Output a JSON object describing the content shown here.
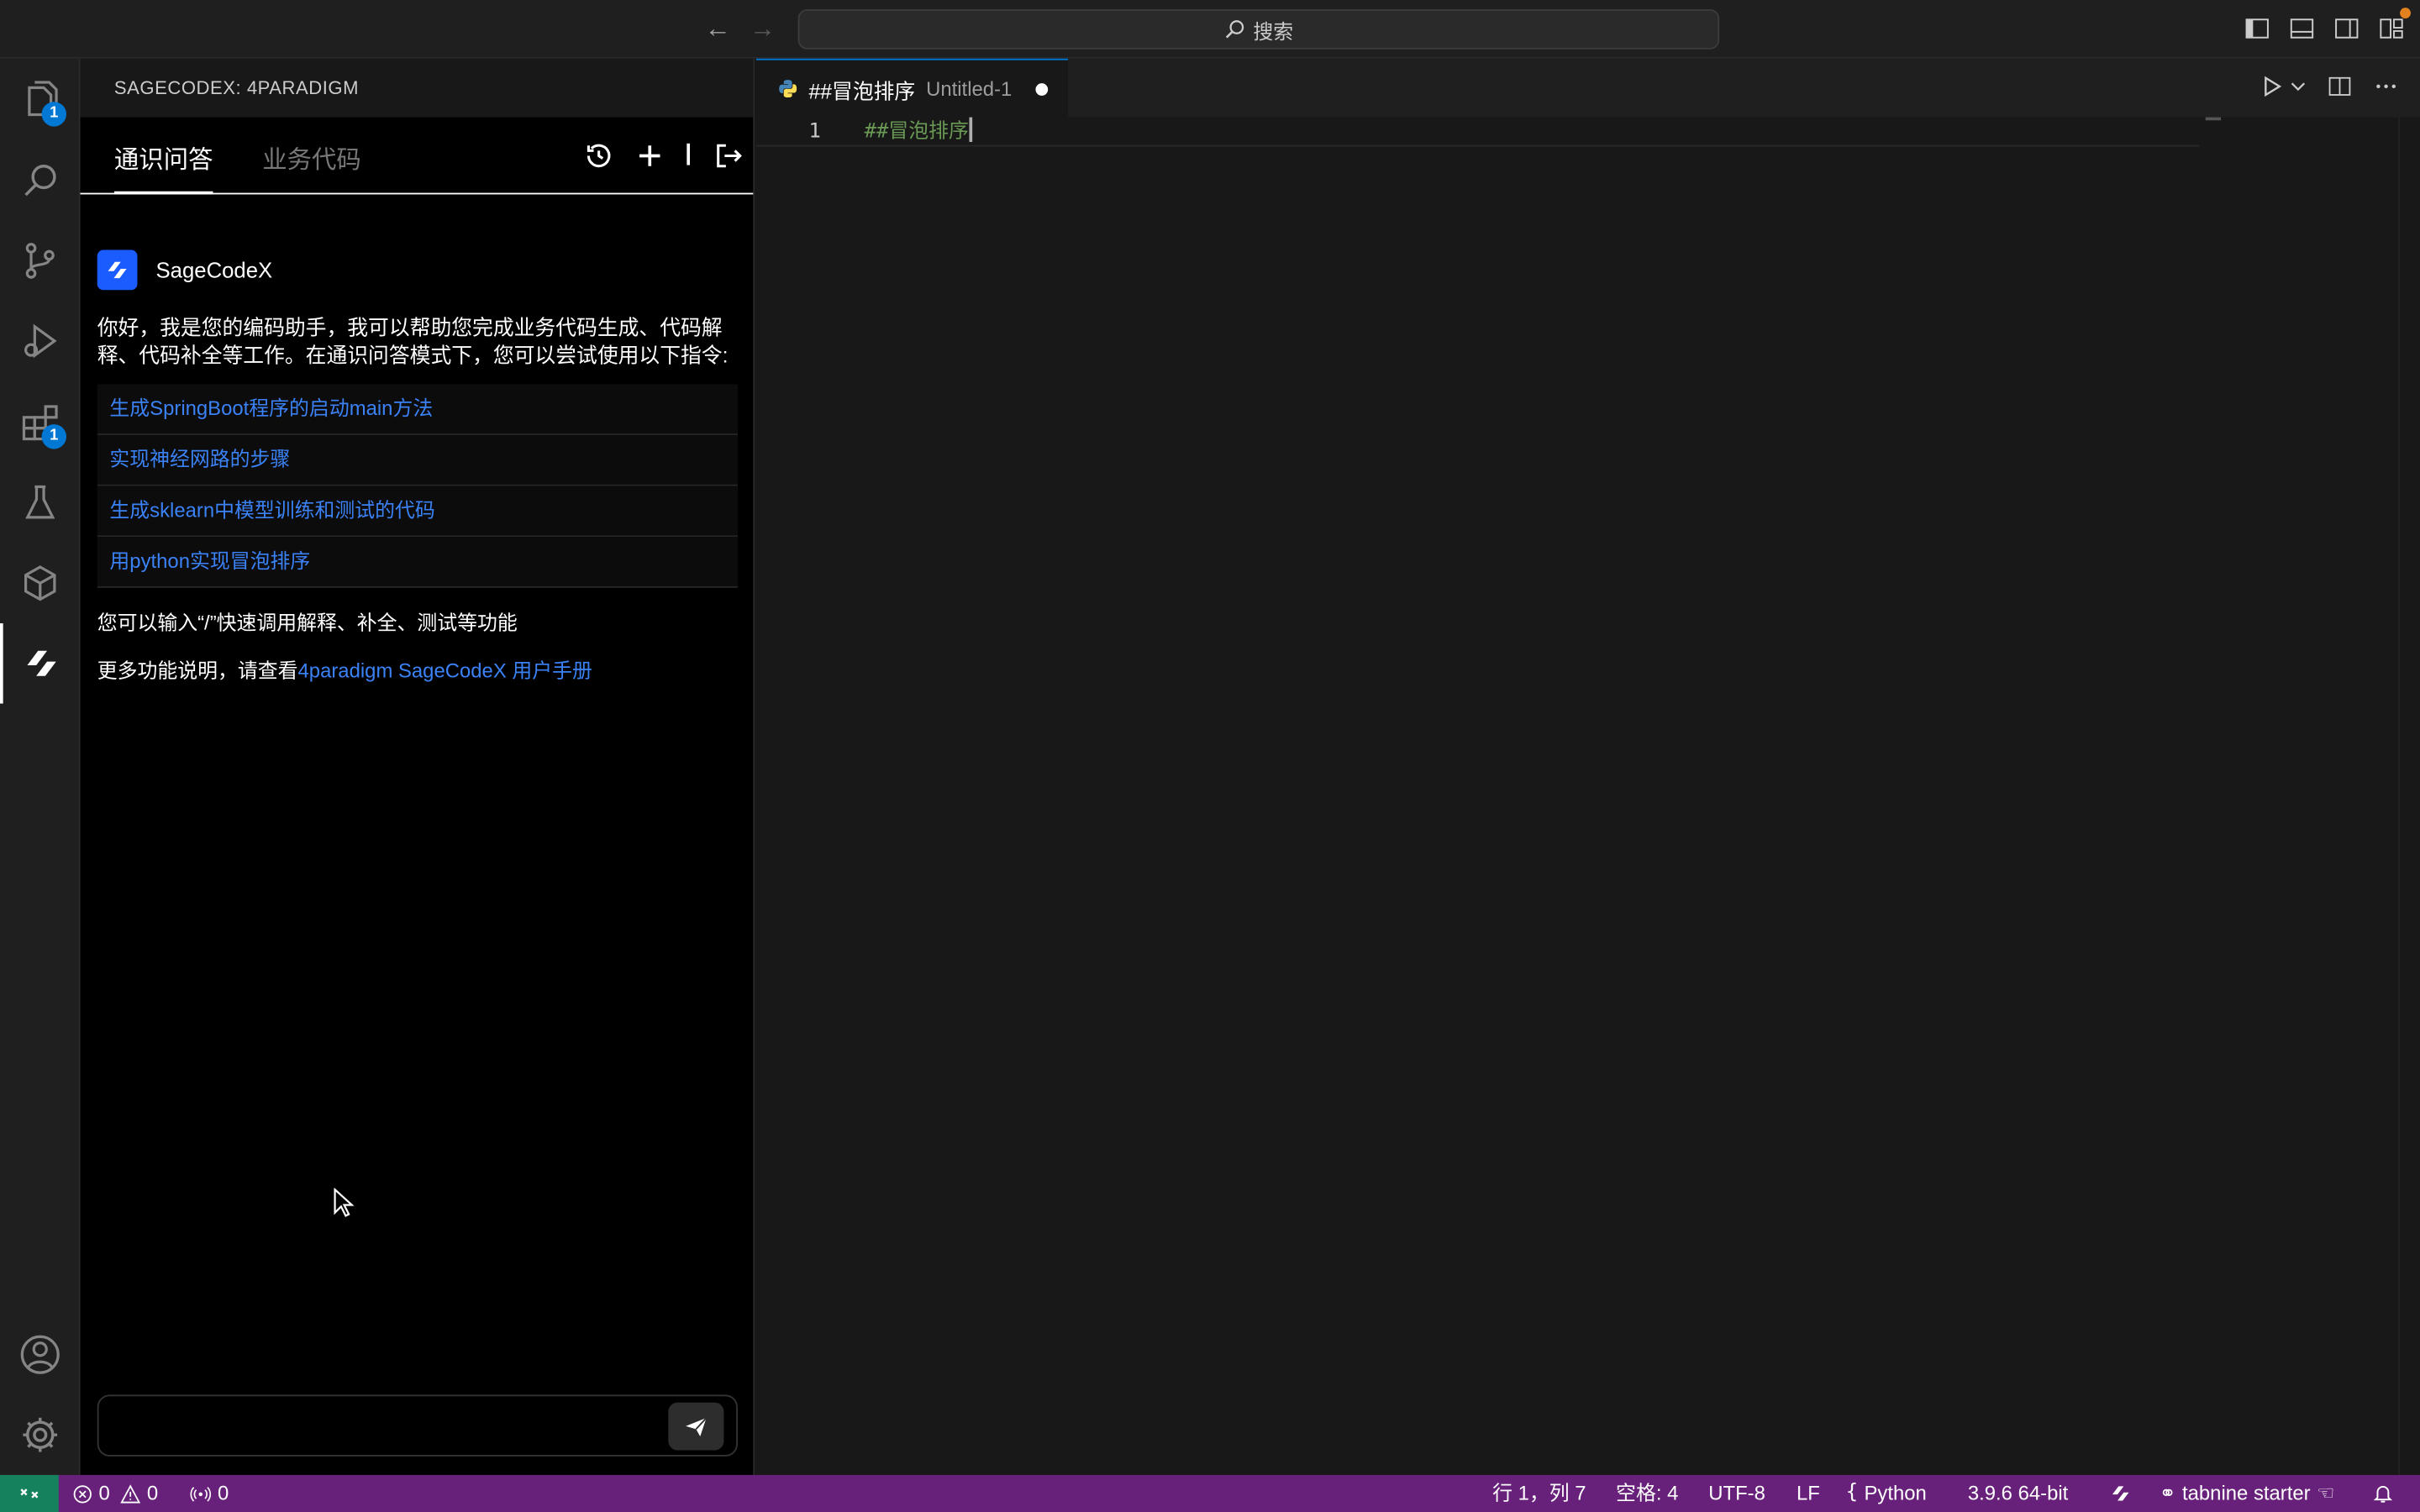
{
  "titlebar": {
    "search_label": "搜索"
  },
  "activity": {
    "explorer_badge": "1",
    "extensions_badge": "1"
  },
  "sidebar": {
    "title": "SAGECODEX: 4PARADIGM",
    "tabs": [
      "通识问答",
      "业务代码"
    ],
    "bot_name": "SageCodeX",
    "intro": "你好，我是您的编码助手，我可以帮助您完成业务代码生成、代码解释、代码补全等工作。在通识问答模式下，您可以尝试使用以下指令:",
    "suggestions": [
      "生成SpringBoot程序的启动main方法",
      "实现神经网路的步骤",
      "生成sklearn中模型训练和测试的代码",
      "用python实现冒泡排序"
    ],
    "tip": "您可以输入“/”快速调用解释、补全、测试等功能",
    "more_prefix": "更多功能说明，请查看",
    "more_link": "4paradigm SageCodeX 用户手册",
    "input_placeholder": ""
  },
  "editor": {
    "tab_name": "##冒泡排序",
    "tab_desc": "Untitled-1",
    "line_number": "1",
    "code": "##冒泡排序"
  },
  "statusbar": {
    "errors": "0",
    "warnings": "0",
    "ports": "0",
    "position": "行 1，列 7",
    "spaces": "空格: 4",
    "encoding": "UTF-8",
    "eol": "LF",
    "language": "Python",
    "interpreter": "3.9.6 64-bit",
    "tabnine": "tabnine starter"
  },
  "colors": {
    "accent": "#0078d4",
    "statusbar": "#68217a",
    "remote": "#16825d",
    "link": "#3b82f6",
    "comment": "#6a9955"
  }
}
